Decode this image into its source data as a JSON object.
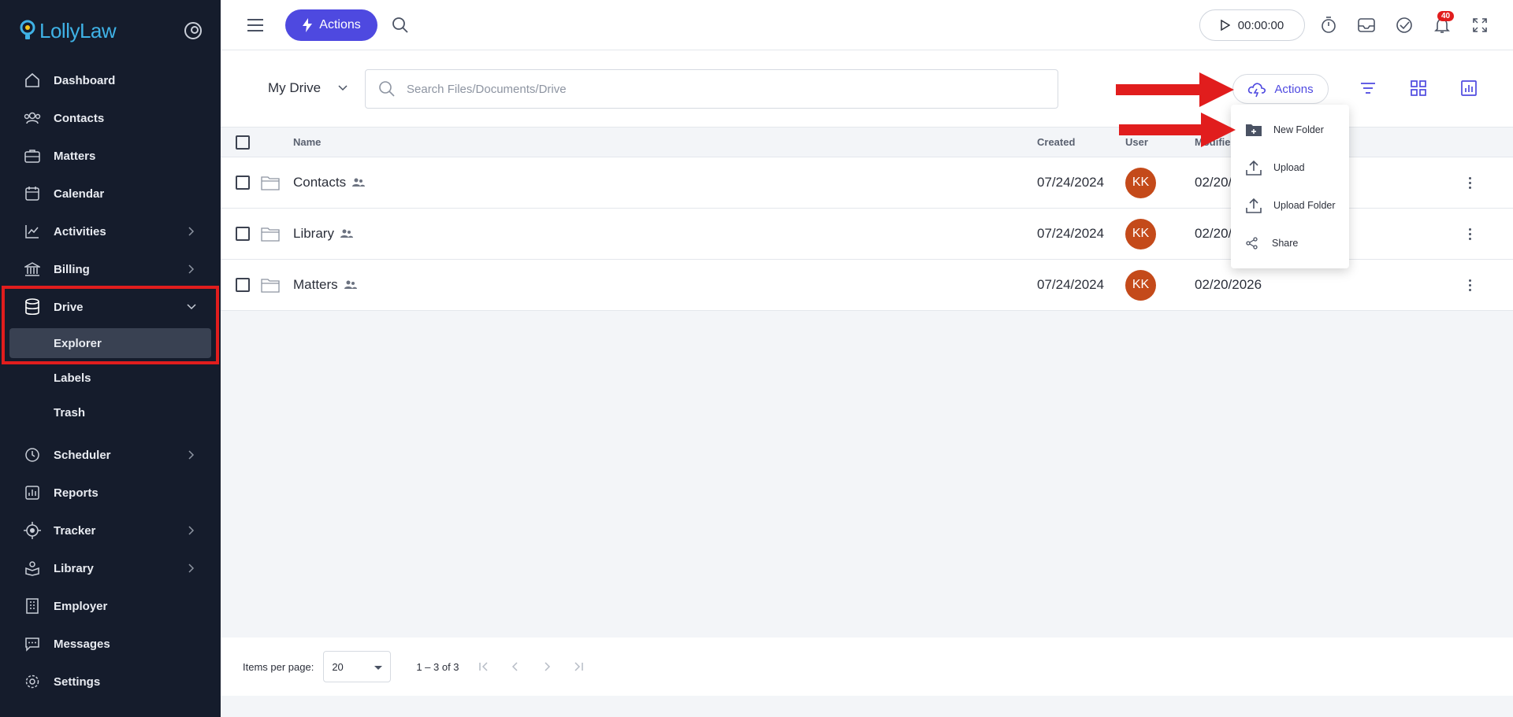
{
  "brand": {
    "name": "LollyLaw"
  },
  "sidebar": {
    "items": [
      {
        "label": "Dashboard",
        "icon": "home-icon",
        "has_submenu": false
      },
      {
        "label": "Contacts",
        "icon": "contacts-icon",
        "has_submenu": false
      },
      {
        "label": "Matters",
        "icon": "briefcase-icon",
        "has_submenu": false
      },
      {
        "label": "Calendar",
        "icon": "calendar-icon",
        "has_submenu": false
      },
      {
        "label": "Activities",
        "icon": "chart-line-icon",
        "has_submenu": true
      },
      {
        "label": "Billing",
        "icon": "bank-icon",
        "has_submenu": true
      },
      {
        "label": "Drive",
        "icon": "database-icon",
        "has_submenu": true,
        "expanded": true
      },
      {
        "label": "Scheduler",
        "icon": "clock-icon",
        "has_submenu": true
      },
      {
        "label": "Reports",
        "icon": "report-icon",
        "has_submenu": false
      },
      {
        "label": "Tracker",
        "icon": "crosshair-icon",
        "has_submenu": true
      },
      {
        "label": "Library",
        "icon": "library-icon",
        "has_submenu": true
      },
      {
        "label": "Employer",
        "icon": "building-icon",
        "has_submenu": false
      },
      {
        "label": "Messages",
        "icon": "message-icon",
        "has_submenu": false
      },
      {
        "label": "Settings",
        "icon": "gear-icon",
        "has_submenu": false
      }
    ],
    "drive_sub": [
      {
        "label": "Explorer",
        "active": true
      },
      {
        "label": "Labels",
        "active": false
      },
      {
        "label": "Trash",
        "active": false
      }
    ]
  },
  "topbar": {
    "actions_label": "Actions",
    "timer": "00:00:00",
    "notifications_count": "40"
  },
  "toolbar": {
    "drive_selector": "My Drive",
    "search_placeholder": "Search Files/Documents/Drive",
    "actions_label": "Actions"
  },
  "table": {
    "headers": {
      "name": "Name",
      "created": "Created",
      "user": "User",
      "modified": "Modifie"
    },
    "rows": [
      {
        "name": "Contacts",
        "created": "07/24/2024",
        "user": "KK",
        "modified": "02/20/"
      },
      {
        "name": "Library",
        "created": "07/24/2024",
        "user": "KK",
        "modified": "02/20/"
      },
      {
        "name": "Matters",
        "created": "07/24/2024",
        "user": "KK",
        "modified": "02/20/2026"
      }
    ]
  },
  "actions_menu": {
    "items": [
      {
        "label": "New Folder",
        "icon": "new-folder-icon"
      },
      {
        "label": "Upload",
        "icon": "upload-icon"
      },
      {
        "label": "Upload Folder",
        "icon": "upload-folder-icon"
      },
      {
        "label": "Share",
        "icon": "share-icon"
      }
    ]
  },
  "paginator": {
    "label": "Items per page:",
    "page_size": "20",
    "range": "1 – 3 of 3"
  },
  "colors": {
    "sidebar_bg": "#151c2c",
    "accent": "#4e49e0",
    "avatar": "#c44a1a",
    "highlight": "#e11d1d"
  }
}
